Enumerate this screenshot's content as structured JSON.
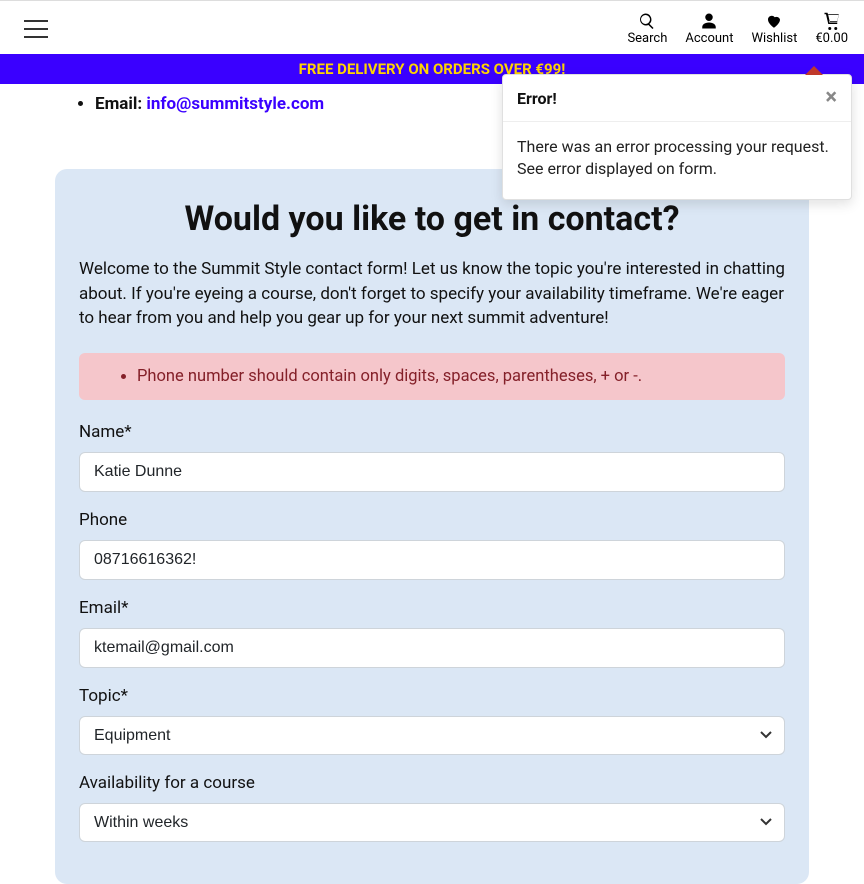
{
  "header": {
    "search_label": "Search",
    "account_label": "Account",
    "wishlist_label": "Wishlist",
    "cart_amount": "€0.00"
  },
  "banner": {
    "text": "FREE DELIVERY ON ORDERS OVER €99!"
  },
  "info": {
    "email_label": "Email: ",
    "email_value": "info@summitstyle.com"
  },
  "toast": {
    "title": "Error!",
    "close": "×",
    "body": "There was an error processing your request. See error displayed on form."
  },
  "card": {
    "title": "Would you like to get in contact?",
    "intro": "Welcome to the Summit Style contact form! Let us know the topic you're interested in chatting about. If you're eyeing a course, don't forget to specify your availability timeframe. We're eager to hear from you and help you gear up for your next summit adventure!"
  },
  "alert": {
    "items": [
      "Phone number should contain only digits, spaces, parentheses, + or -."
    ]
  },
  "form": {
    "name": {
      "label": "Name*",
      "value": "Katie Dunne"
    },
    "phone": {
      "label": "Phone",
      "value": "08716616362!"
    },
    "email": {
      "label": "Email*",
      "value": "ktemail@gmail.com"
    },
    "topic": {
      "label": "Topic*",
      "selected": "Equipment"
    },
    "availability": {
      "label": "Availability for a course",
      "selected": "Within weeks"
    }
  }
}
